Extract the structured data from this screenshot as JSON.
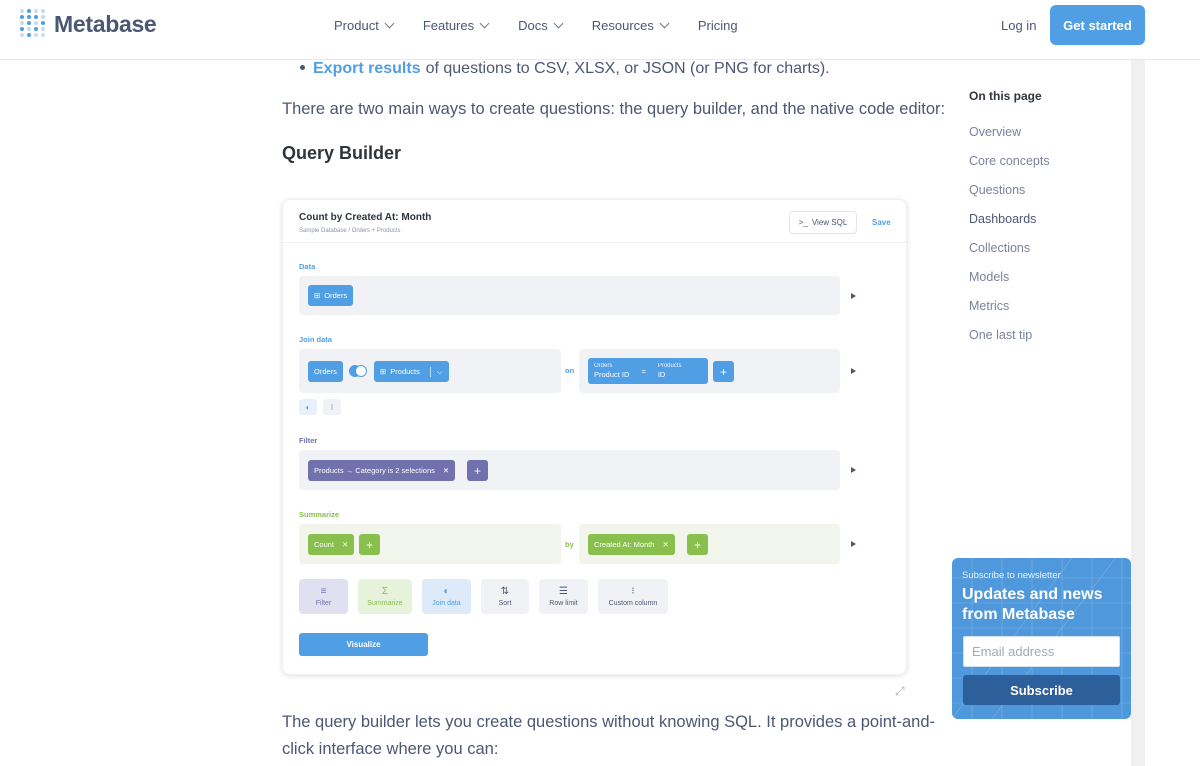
{
  "header": {
    "logo_text": "Metabase",
    "nav": [
      {
        "label": "Product",
        "has_menu": true
      },
      {
        "label": "Features",
        "has_menu": true
      },
      {
        "label": "Docs",
        "has_menu": true
      },
      {
        "label": "Resources",
        "has_menu": true
      },
      {
        "label": "Pricing",
        "has_menu": false
      }
    ],
    "login": "Log in",
    "get_started": "Get started"
  },
  "article": {
    "bullet_link": "Export results",
    "bullet_text": "of questions to CSV, XLSX, or JSON (or PNG for charts).",
    "para1": "There are two main ways to create questions: the query builder, and the native code editor:",
    "heading": "Query Builder",
    "para2_line1": "The query builder lets you create questions without knowing SQL. It provides a point-and-",
    "para2_line2": "click interface where you can:"
  },
  "screenshot": {
    "title": "Count by Created At: Month",
    "subtitle": "Sample Database  /  Orders + Products",
    "view_sql": "View SQL",
    "save": "Save",
    "data_label": "Data",
    "data_table": "Orders",
    "join_label": "Join data",
    "join_left": "Orders",
    "join_right": "Products",
    "join_on": "on",
    "join_cond_left_table": "Orders",
    "join_cond_left_col": "Product ID",
    "join_cond_op": "=",
    "join_cond_right_table": "Products",
    "join_cond_right_col": "ID",
    "filter_label": "Filter",
    "filter_pill": "Products → Category is 2 selections",
    "summarize_label": "Summarize",
    "metric": "Count",
    "by": "by",
    "breakout": "Created At: Month",
    "tools": [
      "Filter",
      "Summarize",
      "Join data",
      "Sort",
      "Row limit",
      "Custom column"
    ],
    "visualize": "Visualize"
  },
  "toc": {
    "title": "On this page",
    "items": [
      "Overview",
      "Core concepts",
      "Questions",
      "Dashboards",
      "Collections",
      "Models",
      "Metrics",
      "One last tip"
    ]
  },
  "newsletter": {
    "kicker": "Subscribe to newsletter",
    "headline": "Updates and news from Metabase",
    "email_placeholder": "Email address",
    "subscribe": "Subscribe"
  },
  "colors": {
    "brand_blue": "#509ee3",
    "filter_purple": "#7172ad",
    "summarize_green": "#88bf4d",
    "text": "#4c5773"
  }
}
